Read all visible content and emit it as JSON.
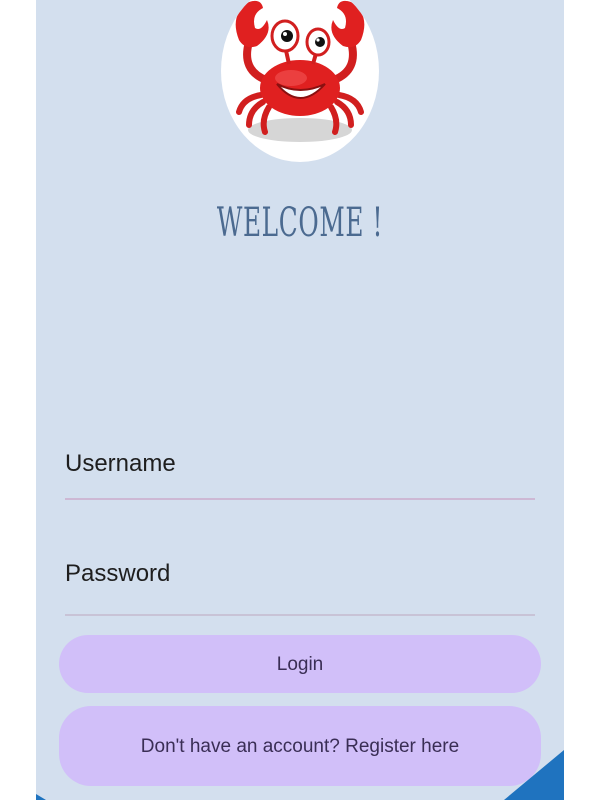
{
  "header": {
    "logo_icon": "crab-mascot-icon",
    "welcome_text": "WELCOME !"
  },
  "form": {
    "username_placeholder": "Username",
    "password_placeholder": "Password"
  },
  "actions": {
    "login_label": "Login",
    "register_label": "Don't have an account? Register here"
  },
  "colors": {
    "background": "#d3dfee",
    "button": "#d1bff9",
    "welcome_text": "#4b6a90",
    "accent": "#1f73bf",
    "crab": "#e02020"
  }
}
